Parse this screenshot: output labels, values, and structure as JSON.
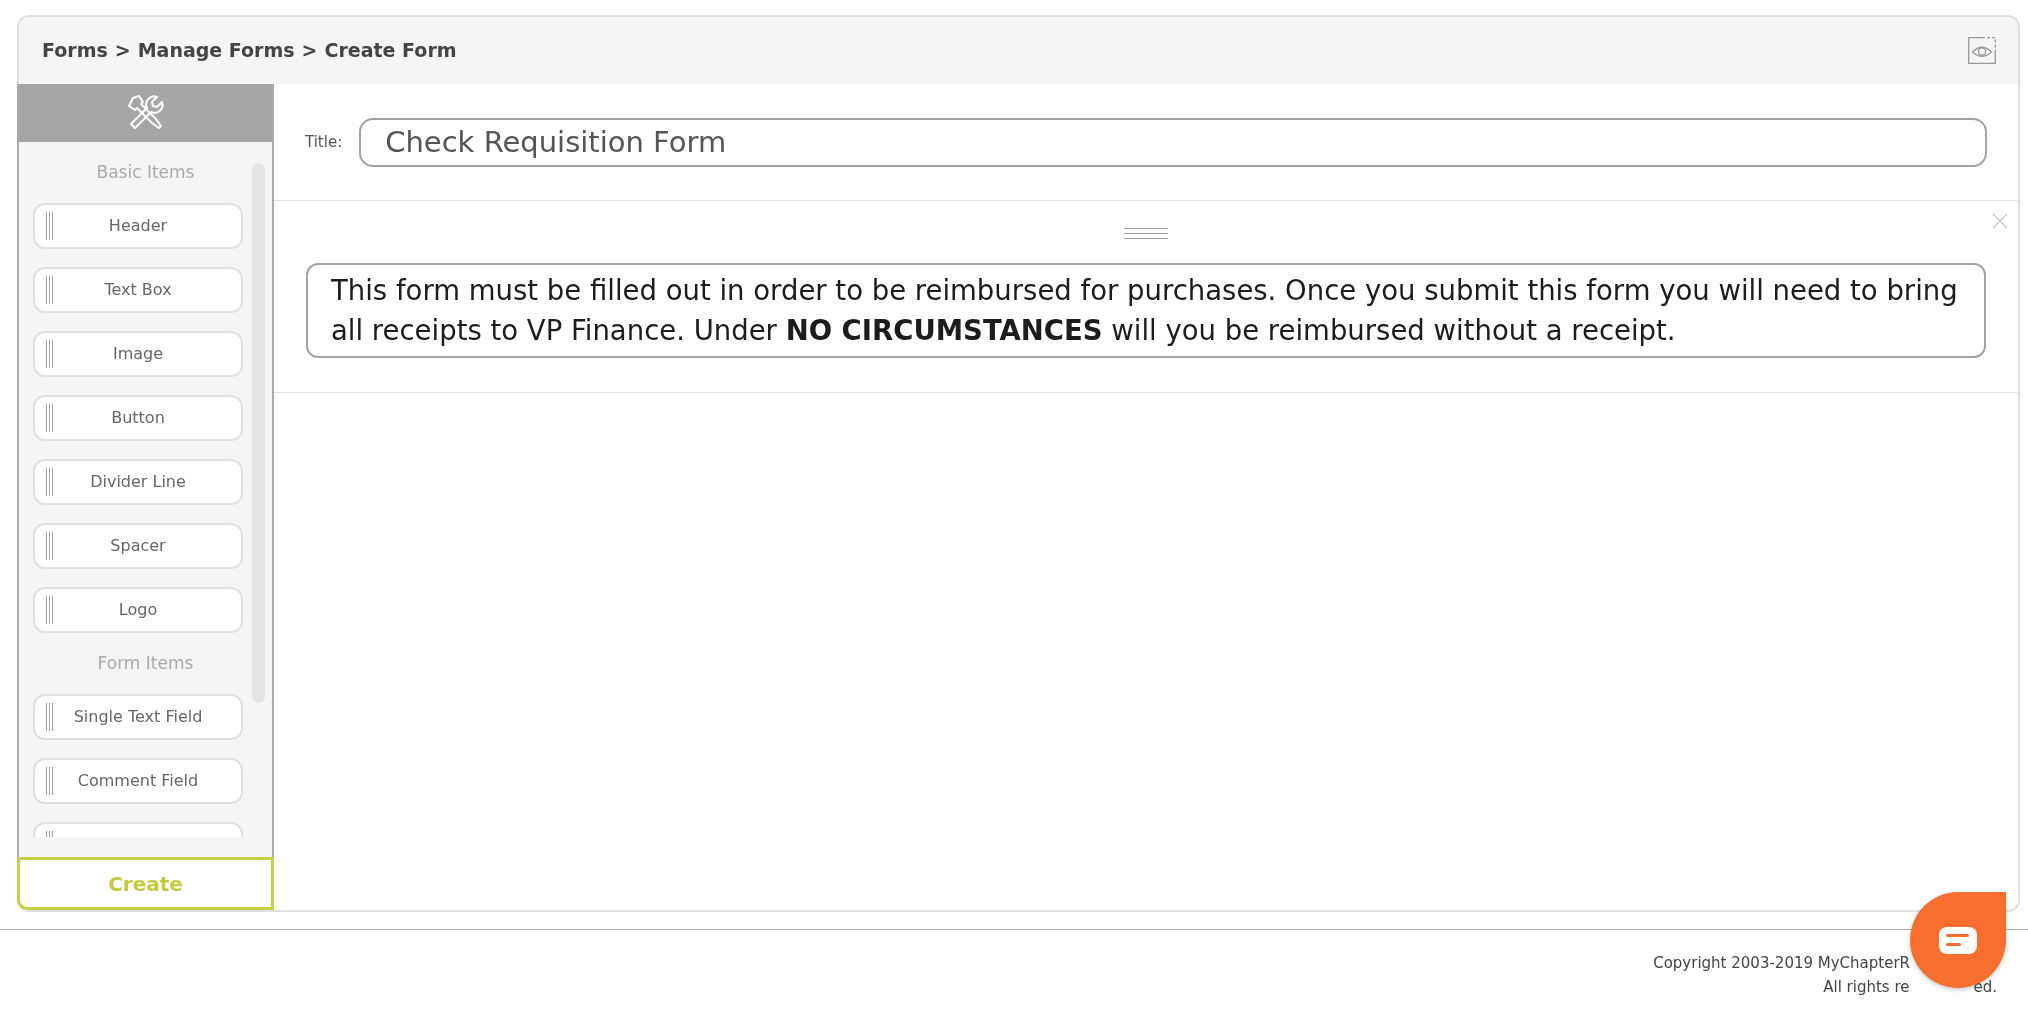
{
  "header": {
    "breadcrumb": [
      {
        "kind": "link",
        "text": "Forms"
      },
      {
        "kind": "separator",
        "text": ">"
      },
      {
        "kind": "link",
        "text": "Manage Forms"
      },
      {
        "kind": "separator",
        "text": ">"
      },
      {
        "kind": "link",
        "text": "Create Form"
      }
    ]
  },
  "toolbox": {
    "sections": [
      {
        "heading": "Basic Items",
        "items": [
          {
            "kind": "item",
            "label": "Header"
          },
          {
            "kind": "item",
            "label": "Text Box"
          },
          {
            "kind": "item",
            "label": "Image"
          },
          {
            "kind": "item",
            "label": "Button"
          },
          {
            "kind": "item",
            "label": "Divider Line"
          },
          {
            "kind": "item",
            "label": "Spacer"
          },
          {
            "kind": "item",
            "label": "Logo"
          }
        ]
      },
      {
        "heading": "Form Items",
        "items": [
          {
            "kind": "item",
            "label": "Single Text Field"
          },
          {
            "kind": "item",
            "label": "Comment Field"
          },
          {
            "kind": "partial"
          }
        ]
      }
    ],
    "create_button": "Create"
  },
  "title_field": {
    "label": "Title:",
    "value": "Check Requisition Form"
  },
  "canvas_items": [
    {
      "kind": "text_block",
      "text": "This form must be filled out in order to be reimbursed for purchases. Once you submit this form you will need to bring all receipts to VP Finance. Under **NO CIRCUMSTANCES** will you be reimbursed without a receipt."
    }
  ],
  "footer": {
    "lines": [
      [
        "Copyright 2003-2019 MyChapterR"
      ],
      [
        "All rights re",
        "ed."
      ]
    ]
  }
}
